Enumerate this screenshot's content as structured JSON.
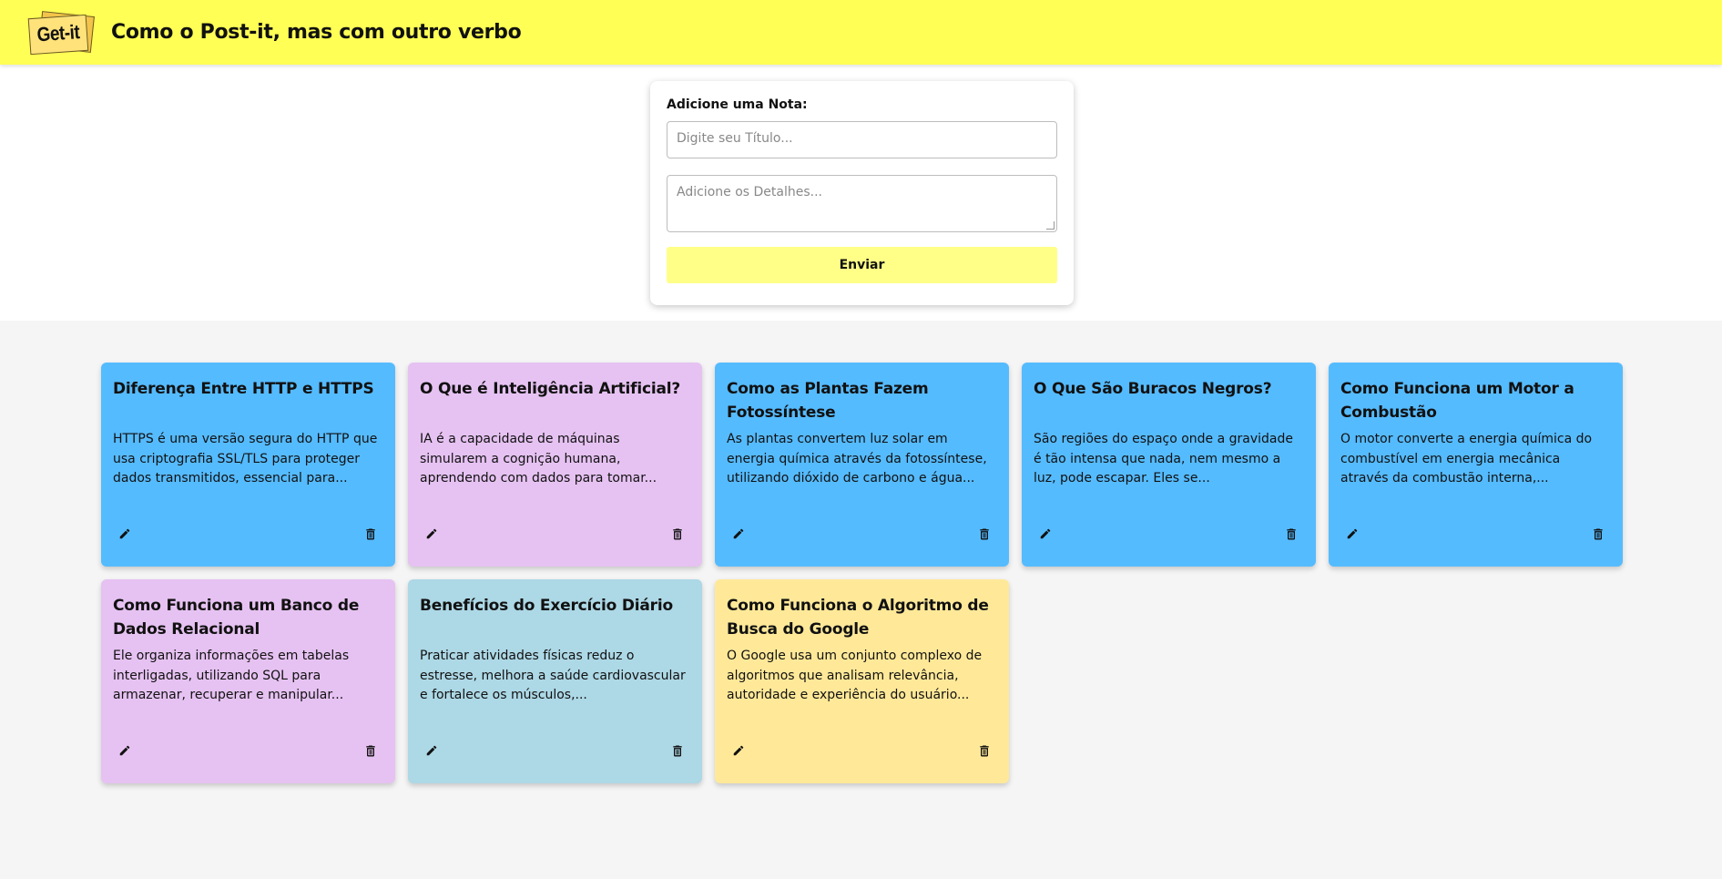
{
  "header": {
    "logo_text": "Get-it",
    "title": "Como o Post-it, mas com outro verbo",
    "background": "#ffff55"
  },
  "form": {
    "label": "Adicione uma Nota:",
    "title_placeholder": "Digite seu Título...",
    "title_value": "",
    "details_placeholder": "Adicione os Detalhes...",
    "details_value": "",
    "submit_label": "Enviar"
  },
  "notes": [
    {
      "title": "Diferença Entre HTTP e HTTPS",
      "body": "HTTPS é uma versão segura do HTTP que usa criptografia SSL/TLS para proteger dados transmitidos, essencial para...",
      "color": "#55bbff"
    },
    {
      "title": "O Que é Inteligência Artificial?",
      "body": "IA é a capacidade de máquinas simularem a cognição humana, aprendendo com dados para tomar...",
      "color": "#e6c2f2"
    },
    {
      "title": "Como as Plantas Fazem Fotossíntese",
      "body": "As plantas convertem luz solar em energia química através da fotossíntese, utilizando dióxido de carbono e água...",
      "color": "#55bbff"
    },
    {
      "title": "O Que São Buracos Negros?",
      "body": "São regiões do espaço onde a gravidade é tão intensa que nada, nem mesmo a luz, pode escapar. Eles se...",
      "color": "#55bbff"
    },
    {
      "title": "Como Funciona um Motor a Combustão",
      "body": "O motor converte a energia química do combustível em energia mecânica através da combustão interna,...",
      "color": "#55bbff"
    },
    {
      "title": "Como Funciona um Banco de Dados Relacional",
      "body": "Ele organiza informações em tabelas interligadas, utilizando SQL para armazenar, recuperar e manipular...",
      "color": "#e6c2f2"
    },
    {
      "title": "Benefícios do Exercício Diário",
      "body": "Praticar atividades físicas reduz o estresse, melhora a saúde cardiovascular e fortalece os músculos,...",
      "color": "#add8e6"
    },
    {
      "title": "Como Funciona o Algoritmo de Busca do Google",
      "body": "O Google usa um conjunto complexo de algoritmos que analisam relevância, autoridade e experiência do usuário...",
      "color": "#ffe999"
    }
  ],
  "icons": {
    "edit": "pencil-icon",
    "delete": "trash-icon"
  }
}
